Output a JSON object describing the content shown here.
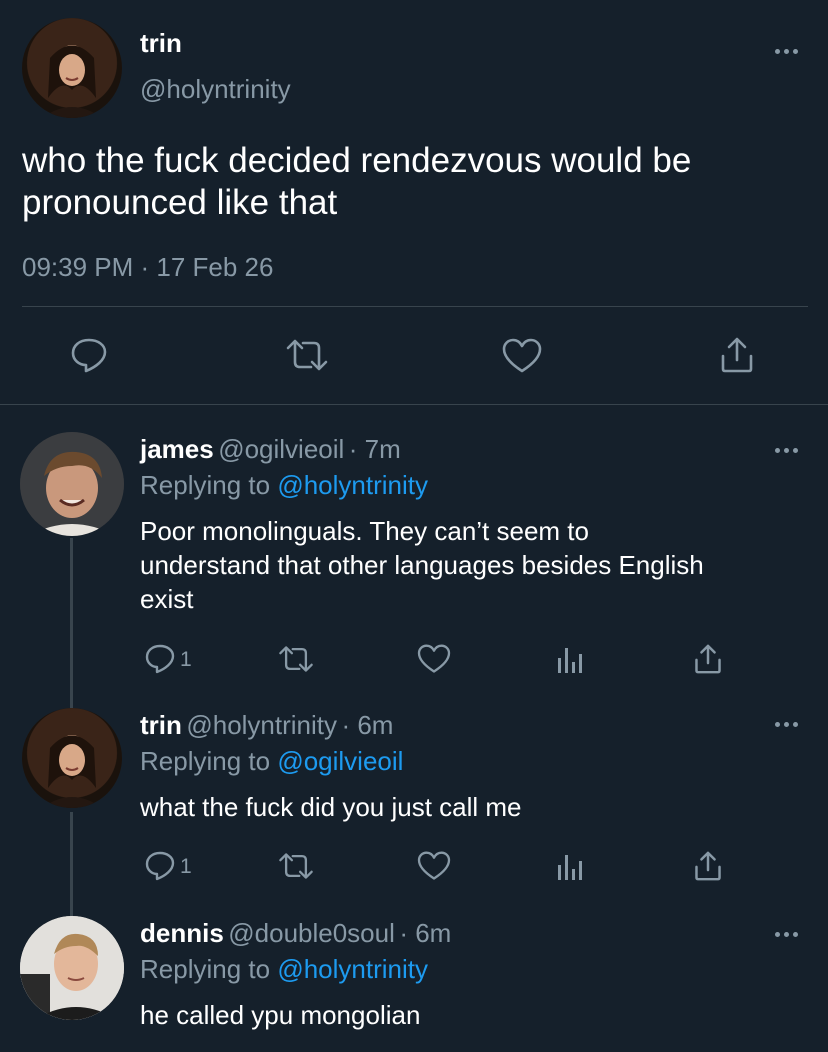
{
  "main_tweet": {
    "name": "trin",
    "handle": "@holyntrinity",
    "text_line1": "who the fuck decided rendezvous would be",
    "text_line2": "pronounced like that",
    "timestamp": "09:39 PM · 17 Feb 26"
  },
  "replies": [
    {
      "name": "james",
      "handle": "@ogilvieoil",
      "time": "· 7m",
      "replying_label": "Replying to",
      "replying_to": "@holyntrinity",
      "text_line1": "Poor monolinguals. They can’t seem to",
      "text_line2": "understand that other languages besides English",
      "text_line3": "exist",
      "reply_count": "1"
    },
    {
      "name": "trin",
      "handle": "@holyntrinity",
      "time": "· 6m",
      "replying_label": "Replying to",
      "replying_to": "@ogilvieoil",
      "text_line1": "what the fuck did you just call me",
      "reply_count": "1"
    },
    {
      "name": "dennis",
      "handle": "@double0soul",
      "time": "· 6m",
      "replying_label": "Replying to",
      "replying_to": "@holyntrinity",
      "text_line1": "he called ypu mongolian"
    }
  ],
  "icons": {
    "reply": "reply-icon",
    "retweet": "retweet-icon",
    "like": "heart-icon",
    "share": "share-icon",
    "analytics": "analytics-icon",
    "more": "more-icon"
  },
  "colors": {
    "background": "#15202b",
    "muted": "#8899a6",
    "link": "#1d9bf0",
    "divider": "#38444d"
  }
}
